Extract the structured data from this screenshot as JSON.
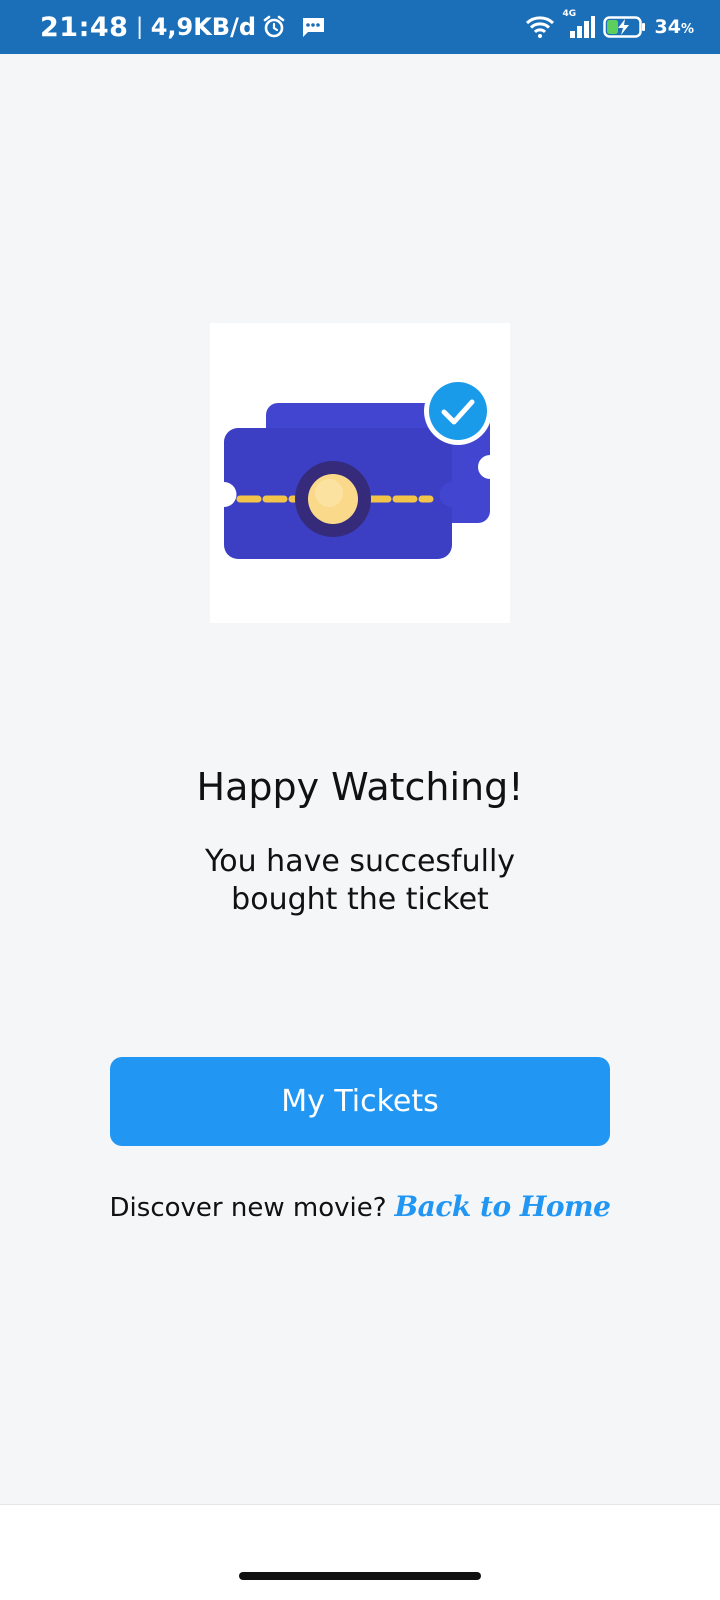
{
  "status_bar": {
    "time": "21:48",
    "separator": "|",
    "speed": "4,9KB/d",
    "battery_percent": "34",
    "battery_unit": "%",
    "network": "4G"
  },
  "illustration": {
    "icon": "ticket-check-icon"
  },
  "content": {
    "title": "Happy Watching!",
    "subtitle_line1": "You have succesfully",
    "subtitle_line2": "bought the ticket"
  },
  "actions": {
    "my_tickets_label": "My Tickets",
    "discover_text": "Discover new movie?",
    "back_home_label": "Back to Home"
  },
  "colors": {
    "status_bar": "#1b6fb8",
    "primary": "#2196f3",
    "ticket": "#4245d0",
    "background": "#f5f6f8"
  }
}
